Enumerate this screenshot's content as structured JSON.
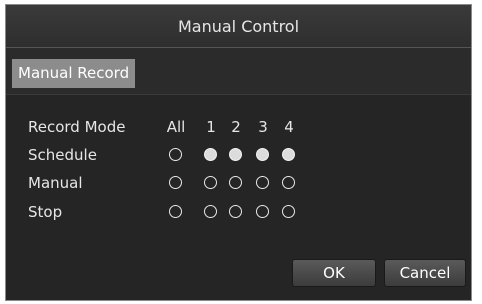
{
  "dialog": {
    "title": "Manual Control",
    "tab": "Manual Record"
  },
  "record_mode": {
    "header_label": "Record Mode",
    "columns": [
      "All",
      "1",
      "2",
      "3",
      "4"
    ],
    "rows": [
      {
        "label": "Schedule",
        "selected": [
          false,
          true,
          true,
          true,
          true
        ]
      },
      {
        "label": "Manual",
        "selected": [
          false,
          false,
          false,
          false,
          false
        ]
      },
      {
        "label": "Stop",
        "selected": [
          false,
          false,
          false,
          false,
          false
        ]
      }
    ]
  },
  "buttons": {
    "ok": "OK",
    "cancel": "Cancel"
  },
  "colors": {
    "background": "#2b2b2b",
    "tab_background": "#8c8c8c",
    "text": "#e6e6e6"
  }
}
